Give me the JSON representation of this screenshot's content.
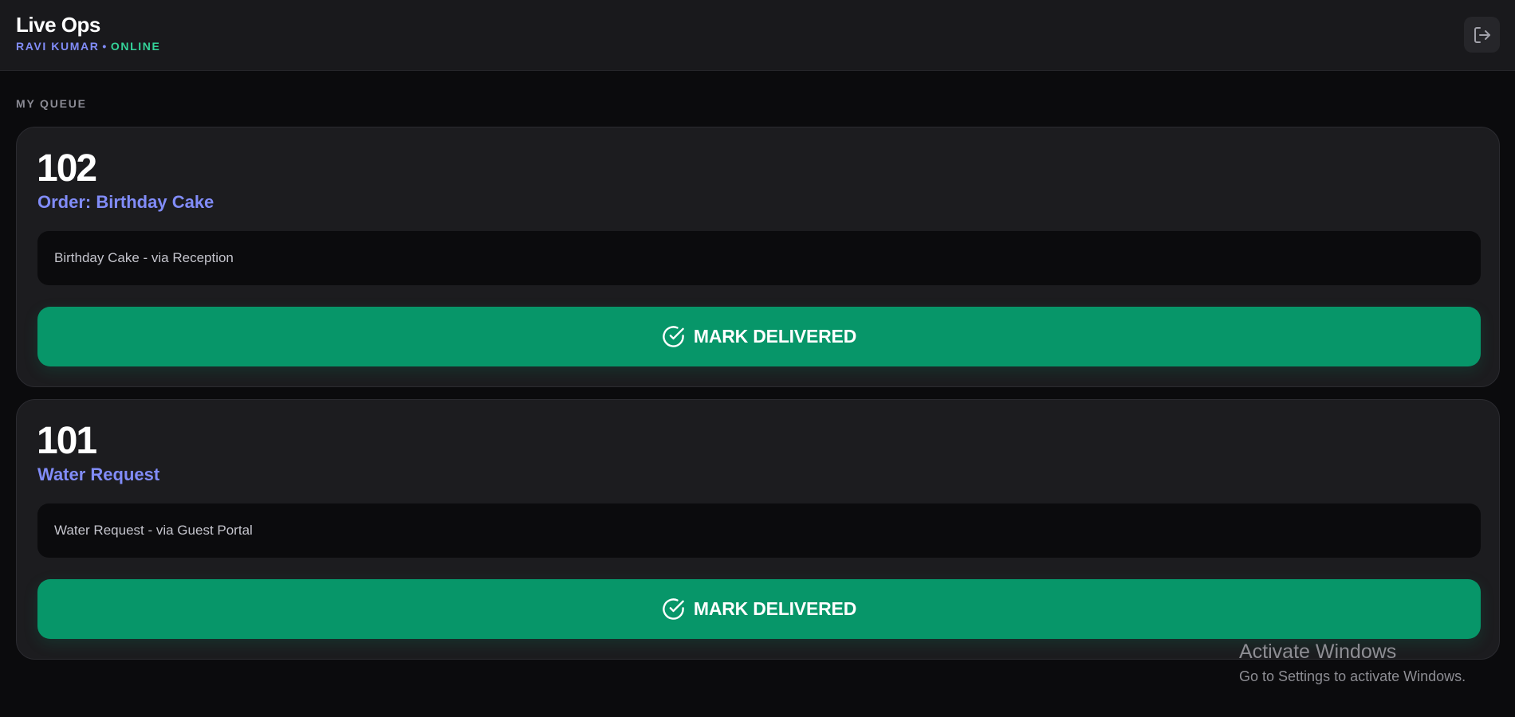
{
  "header": {
    "title": "Live Ops",
    "user_name": "RAVI KUMAR",
    "separator": "•",
    "status": "ONLINE",
    "logout_icon": "logout-icon"
  },
  "queue": {
    "label": "MY QUEUE",
    "items": [
      {
        "room": "102",
        "title": "Order: Birthday Cake",
        "detail": "Birthday Cake - via Reception",
        "action_label": "MARK DELIVERED",
        "action_icon": "check-circle-icon"
      },
      {
        "room": "101",
        "title": "Water Request",
        "detail": "Water Request - via Guest Portal",
        "action_label": "MARK DELIVERED",
        "action_icon": "check-circle-icon"
      }
    ]
  },
  "watermark": {
    "title": "Activate Windows",
    "subtitle": "Go to Settings to activate Windows."
  },
  "colors": {
    "accent": "#818cf8",
    "online": "#34d399",
    "action": "#079669",
    "background": "#0b0b0d",
    "card": "#1c1c1f"
  }
}
